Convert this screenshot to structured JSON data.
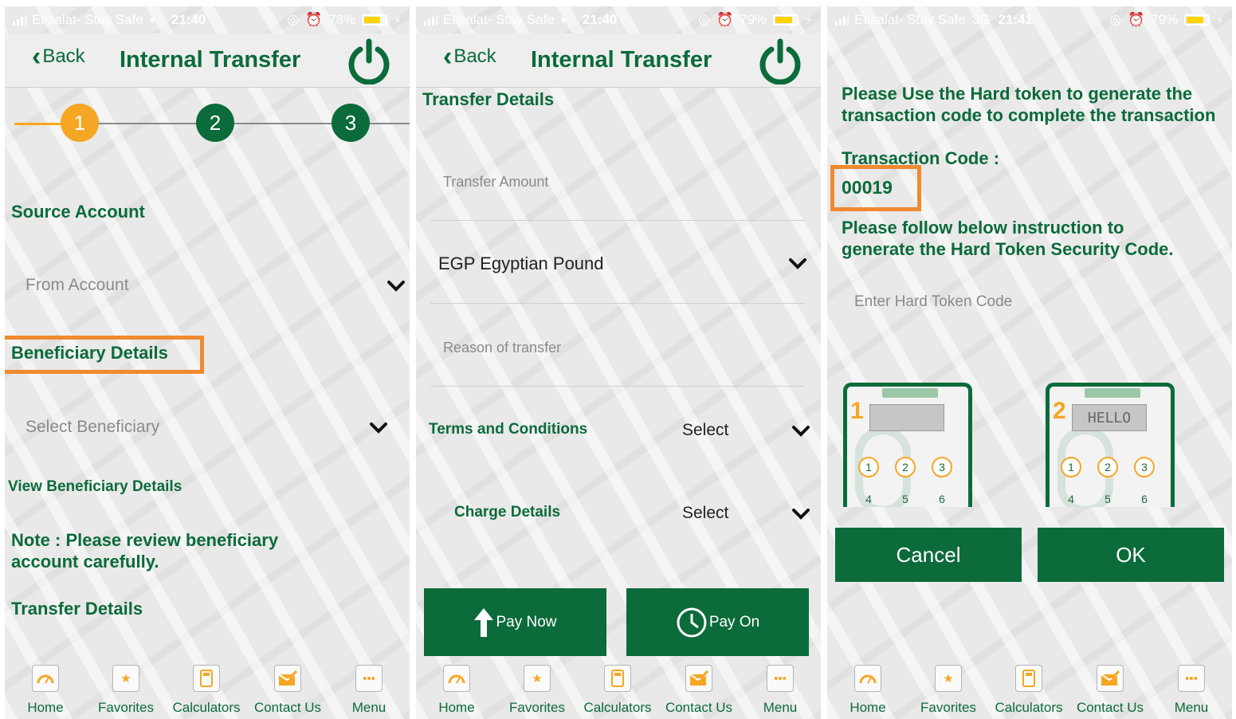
{
  "status_bar": [
    {
      "carrier": "Etisalat- Stay Safe",
      "network": "",
      "time": "21:40",
      "battery": "78%",
      "battery_level": 0.78
    },
    {
      "carrier": "Etisalat- Stay Safe",
      "network": "",
      "time": "21:40",
      "battery": "79%",
      "battery_level": 0.79
    },
    {
      "carrier": "Etisalat- Stay Safe",
      "network": "3G",
      "time": "21:41",
      "battery": "79%",
      "battery_level": 0.79
    }
  ],
  "nav": {
    "back_label": "Back",
    "title": "Internal Transfer"
  },
  "steps": [
    "1",
    "2",
    "3"
  ],
  "screen1": {
    "source_account_heading": "Source Account",
    "from_account_placeholder": "From Account",
    "beneficiary_heading": "Beneficiary Details",
    "select_beneficiary_placeholder": "Select Beneficiary",
    "view_beneficiary_link": "View Beneficiary Details",
    "note_line1": "Note : Please review beneficiary",
    "note_line2": "account carefully.",
    "transfer_details_heading": "Transfer Details"
  },
  "screen2": {
    "transfer_details_heading": "Transfer Details",
    "transfer_amount_placeholder": "Transfer Amount",
    "currency_value": "EGP Egyptian Pound",
    "reason_placeholder": "Reason of transfer",
    "terms_label": "Terms and Conditions",
    "terms_value": "Select",
    "charge_label": "Charge Details",
    "charge_value": "Select",
    "pay_now_label": "Pay Now",
    "pay_on_label": "Pay On"
  },
  "screen3": {
    "instruction_line1": "Please Use the Hard token to generate the",
    "instruction_line2": "transaction code to complete the transaction",
    "transaction_code_label": "Transaction Code :",
    "transaction_code_value": "00019",
    "follow_line1": "Please follow below instruction to",
    "follow_line2": "generate the Hard Token Security Code.",
    "hard_token_placeholder": "Enter Hard Token Code",
    "card1": {
      "step": "1",
      "screen": "",
      "keys": [
        "1",
        "2",
        "3",
        "4",
        "5",
        "6"
      ]
    },
    "card2": {
      "step": "2",
      "screen": "HELLO",
      "keys": [
        "1",
        "2",
        "3",
        "4",
        "5",
        "6"
      ]
    },
    "cancel_label": "Cancel",
    "ok_label": "OK"
  },
  "tabbar": [
    {
      "label": "Home",
      "icon": "speedometer-icon"
    },
    {
      "label": "Favorites",
      "icon": "star-icon"
    },
    {
      "label": "Calculators",
      "icon": "calculator-icon"
    },
    {
      "label": "Contact Us",
      "icon": "envelope-pen-icon"
    },
    {
      "label": "Menu",
      "icon": "more-dots-icon"
    }
  ],
  "colors": {
    "brand_green": "#0b6b3a",
    "accent_orange": "#f5a623",
    "highlight_orange": "#f08a30"
  }
}
